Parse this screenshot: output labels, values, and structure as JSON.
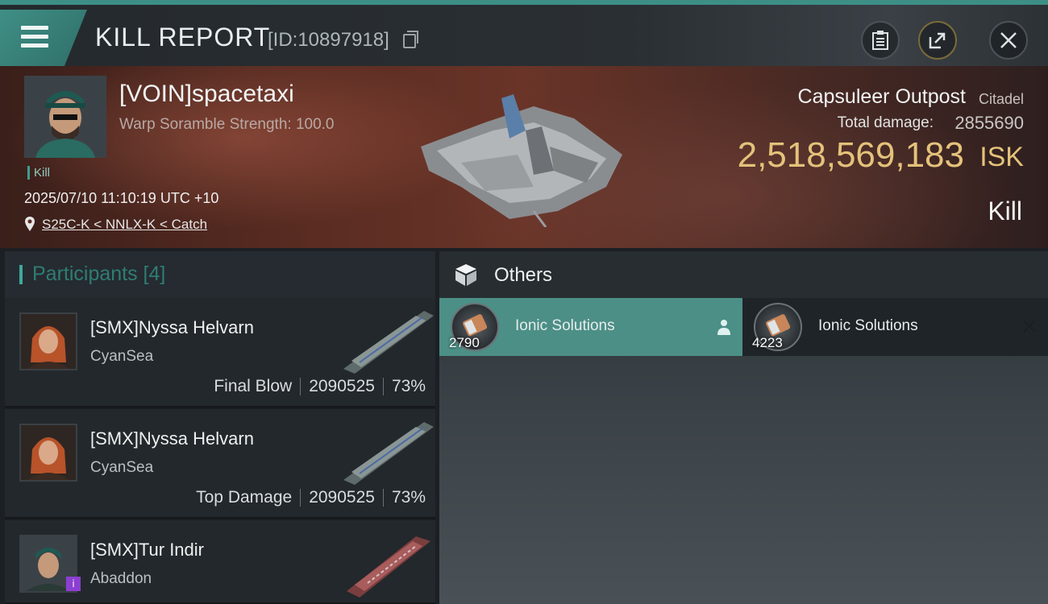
{
  "header": {
    "title": "KILL REPORT",
    "report_id": "[ID:10897918]"
  },
  "victim": {
    "name": "[VOIN]spacetaxi",
    "warp_scramble": "Warp Soramble Strength: 100.0",
    "tag": "Kill",
    "datetime": "2025/07/10 11:10:19 UTC +10",
    "location": "S25C-K < NNLX-K < Catch",
    "ship_name": "Capsuleer Outpost",
    "ship_class": "Citadel",
    "total_damage_label": "Total damage:",
    "total_damage": "2855690",
    "isk_value": "2,518,569,183",
    "isk_unit": "ISK",
    "result": "Kill"
  },
  "participants": {
    "title": "Participants [4]",
    "rows": [
      {
        "name": "[SMX]Nyssa Helvarn",
        "ship": "CyanSea",
        "tag": "Final Blow",
        "damage": "2090525",
        "percent": "73%"
      },
      {
        "name": "[SMX]Nyssa Helvarn",
        "ship": "CyanSea",
        "tag": "Top Damage",
        "damage": "2090525",
        "percent": "73%"
      },
      {
        "name": "[SMX]Tur Indir",
        "ship": "Abaddon"
      }
    ]
  },
  "others": {
    "title": "Others",
    "items": [
      {
        "name": "Ionic Solutions",
        "qty": "2790"
      },
      {
        "name": "Ionic Solutions",
        "qty": "4223"
      }
    ]
  },
  "colors": {
    "accent": "#3f8f86",
    "isk_gold": "#e4c27a",
    "badge_purple": "#8c3fd1"
  },
  "icons": [
    "menu-icon",
    "copy-icon",
    "clipboard-icon",
    "share-icon",
    "close-icon",
    "location-pin-icon",
    "box-icon",
    "person-icon",
    "remove-x-icon"
  ]
}
